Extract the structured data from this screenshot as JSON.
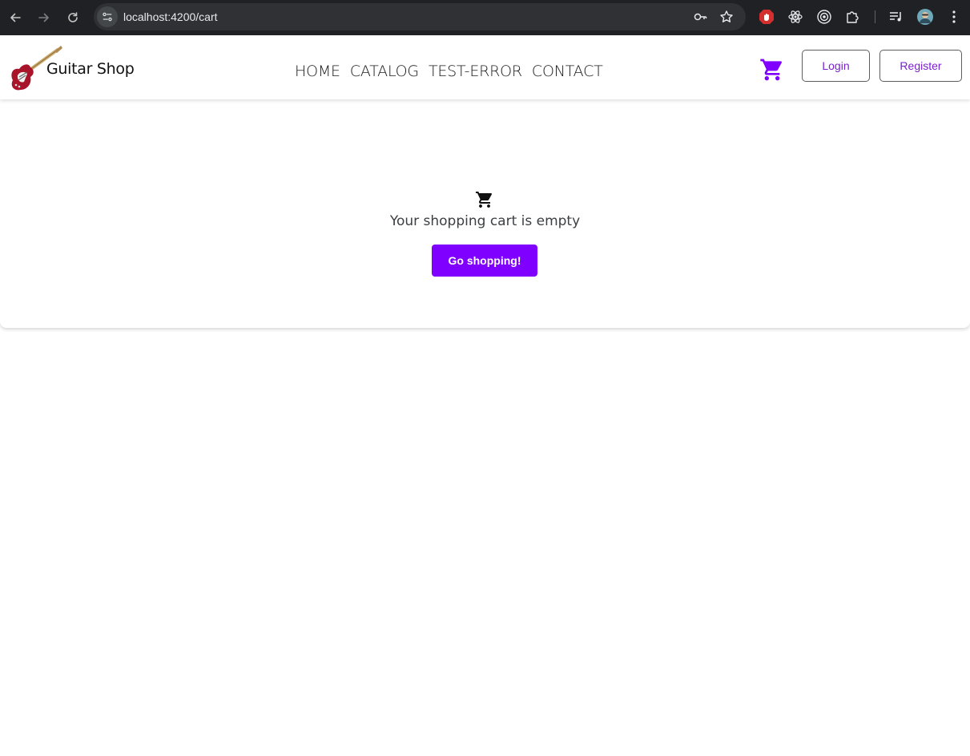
{
  "browser": {
    "url": "localhost:4200/cart",
    "icons": [
      "back-icon",
      "forward-icon",
      "reload-icon",
      "site-info-icon",
      "password-key-icon",
      "bookmark-star-icon",
      "extension-adblock-icon",
      "extension-react-icon",
      "extension-target-icon",
      "extensions-puzzle-icon",
      "media-playlist-icon",
      "profile-avatar-icon",
      "menu-kebab-icon"
    ]
  },
  "header": {
    "logo_text": "Guitar Shop",
    "nav": [
      {
        "label": "HOME"
      },
      {
        "label": "CATALOG"
      },
      {
        "label": "TEST-ERROR"
      },
      {
        "label": "CONTACT"
      }
    ],
    "login_label": "Login",
    "register_label": "Register",
    "accent_color": "#7f00ff"
  },
  "cart": {
    "empty_message": "Your shopping cart is empty",
    "cta_label": "Go shopping!"
  }
}
